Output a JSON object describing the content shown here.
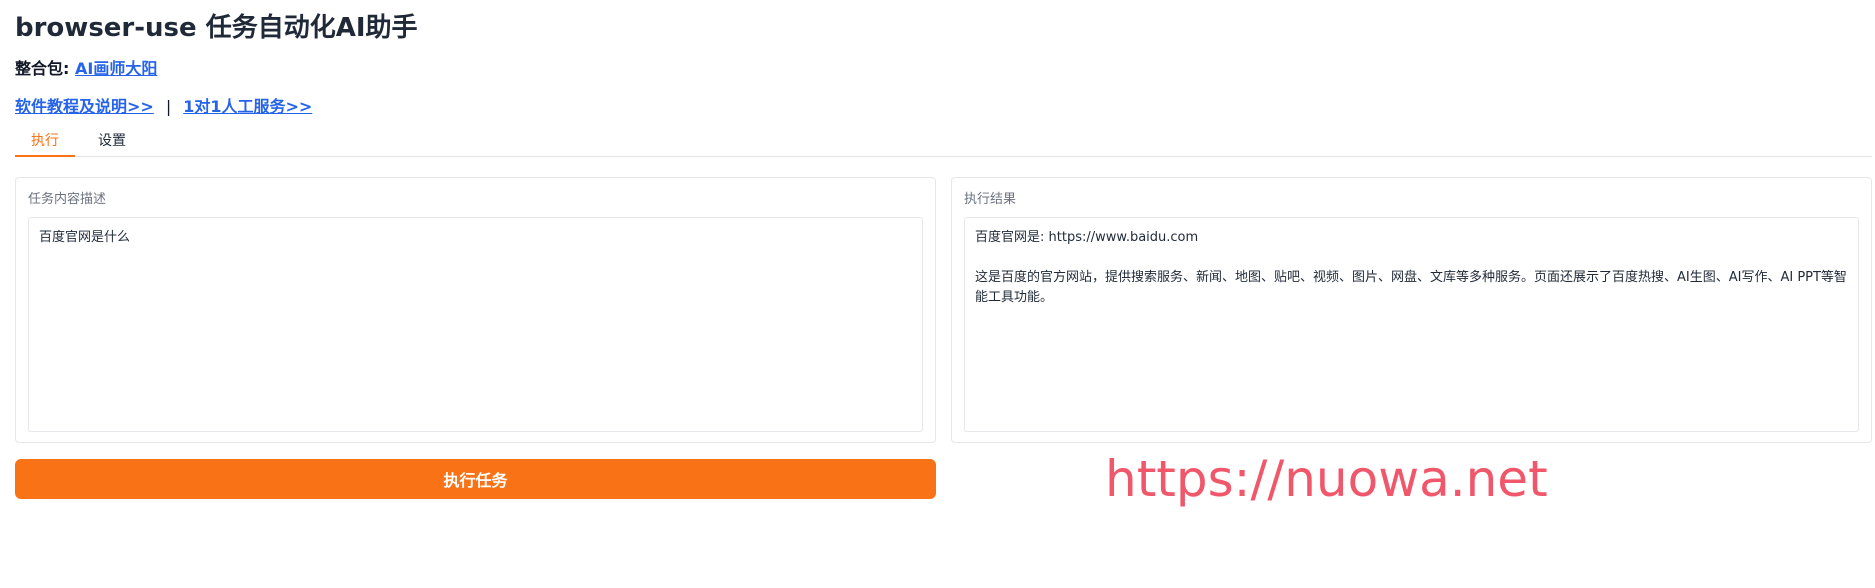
{
  "header": {
    "title": "browser-use 任务自动化AI助手",
    "package_label": "整合包:",
    "package_link": "AI画师大阳",
    "tutorial_link": "软件教程及说明>>",
    "separator": "|",
    "service_link": "1对1人工服务>>"
  },
  "tabs": [
    {
      "label": "执行",
      "active": true
    },
    {
      "label": "设置",
      "active": false
    }
  ],
  "task_panel": {
    "label": "任务内容描述",
    "value": "百度官网是什么"
  },
  "result_panel": {
    "label": "执行结果",
    "line1": "百度官网是: https://www.baidu.com",
    "line2": "这是百度的官方网站，提供搜索服务、新闻、地图、贴吧、视频、图片、网盘、文库等多种服务。页面还展示了百度热搜、AI生图、AI写作、AI PPT等智能工具功能。"
  },
  "run_button": {
    "label": "执行任务"
  },
  "watermark": "https://nuowa.net",
  "colors": {
    "accent": "#f97316",
    "link": "#2563eb",
    "watermark": "#f0576b"
  }
}
